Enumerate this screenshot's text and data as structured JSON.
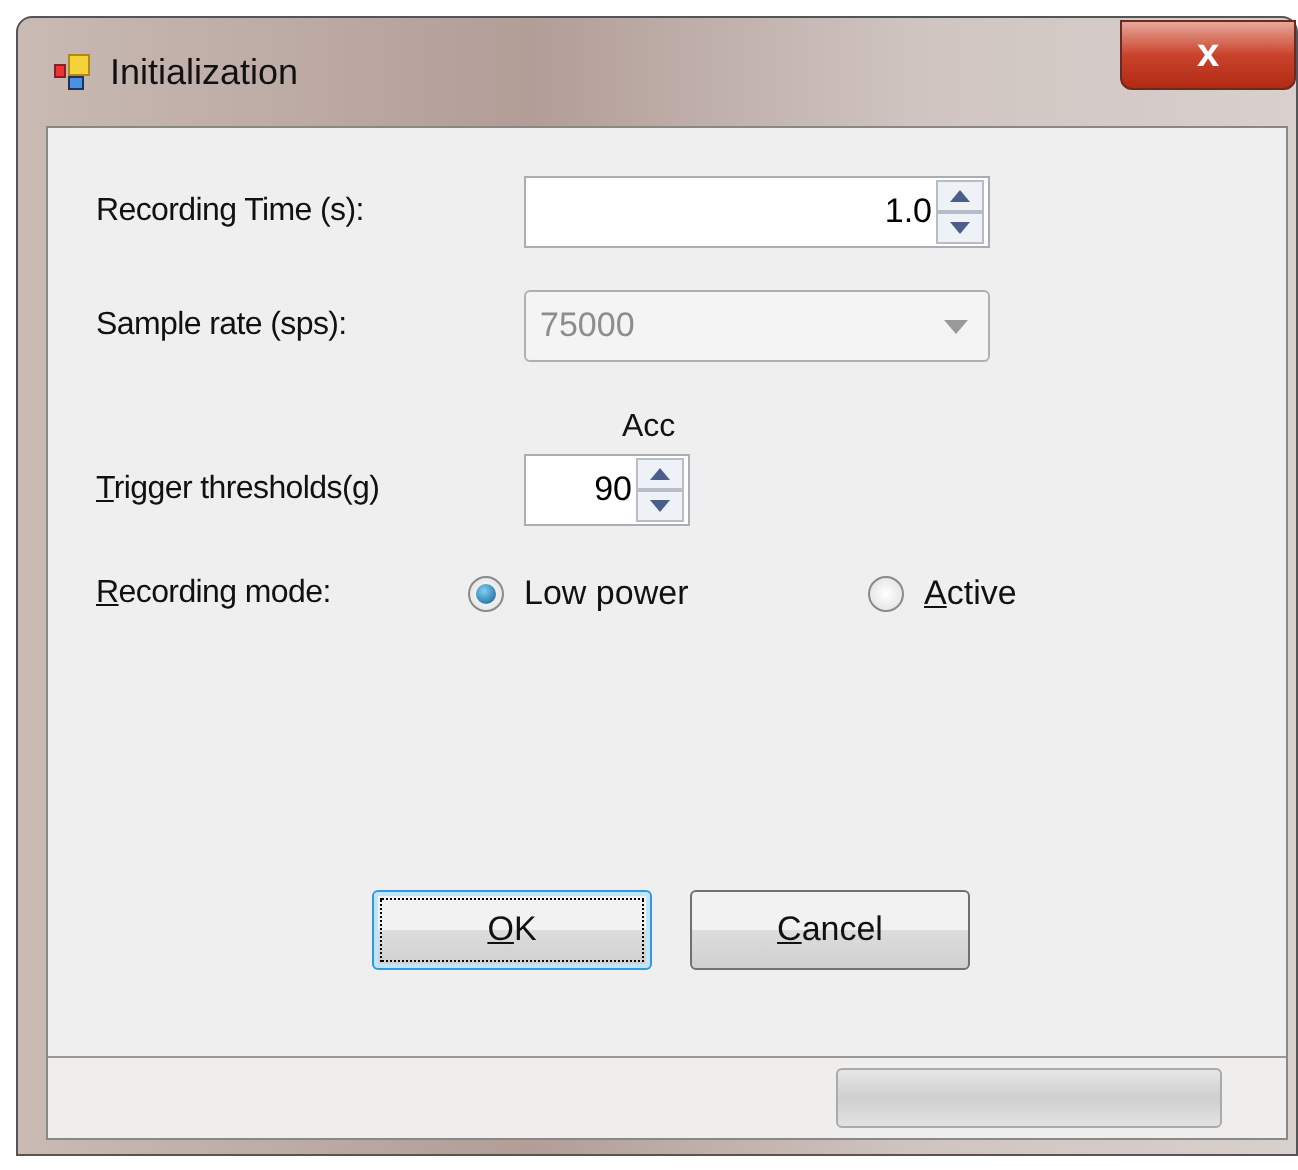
{
  "window": {
    "title": "Initialization",
    "close": "x"
  },
  "recording_time": {
    "label": "Recording Time (s):",
    "value": "1.0"
  },
  "sample_rate": {
    "label": "Sample rate (sps):",
    "value": "75000",
    "disabled": true
  },
  "trigger": {
    "header": "Acc",
    "label": "Trigger thresholds(g)",
    "first_letter_underlined": true,
    "value": "90"
  },
  "recording_mode": {
    "label": "Recording mode:",
    "first_letter_underlined": true,
    "options": [
      {
        "label": "Low power",
        "selected": true
      },
      {
        "label": "Active",
        "first_letter_underlined": true,
        "selected": false
      }
    ]
  },
  "buttons": [
    {
      "label": "OK",
      "first_letter_underlined": true,
      "focused": true
    },
    {
      "label": "Cancel",
      "first_letter_underlined": true,
      "focused": false
    }
  ],
  "status_bar": {
    "progress": {
      "level": 0
    }
  }
}
